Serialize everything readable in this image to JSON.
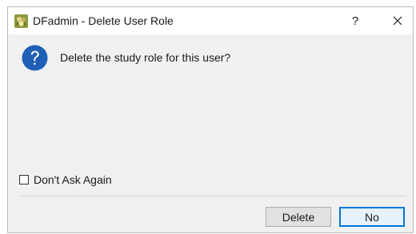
{
  "window": {
    "title": "DFadmin - Delete User Role",
    "help_label": "?",
    "app_icon": "dfadmin-app-icon",
    "close_icon": "close-icon"
  },
  "dialog": {
    "icon": "question-icon",
    "icon_color": "#1f5fb5",
    "message": "Delete the study role for this user?",
    "dont_ask_again": {
      "label": "Don't Ask Again",
      "checked": false
    }
  },
  "buttons": {
    "delete_label": "Delete",
    "no_label": "No",
    "default_button_border": "#0078d7"
  }
}
